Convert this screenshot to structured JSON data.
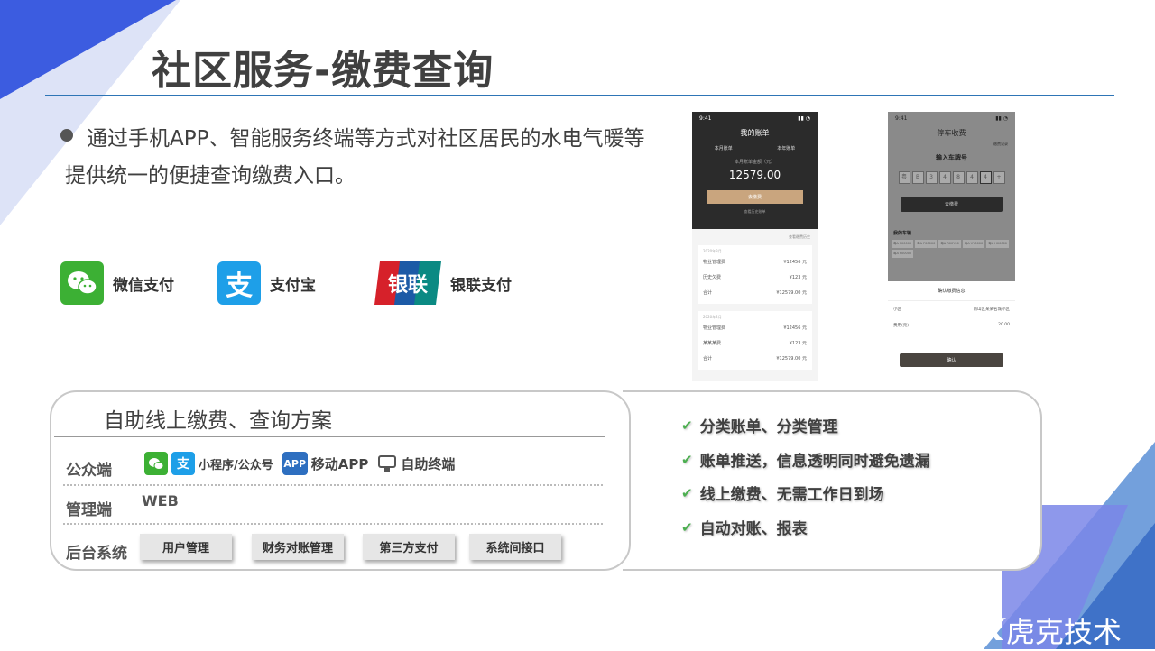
{
  "slide": {
    "title": "社区服务-缴费查询",
    "bullet": "通过手机APP、智能服务终端等方式对社区居民的水电气暖等提供统一的便捷查询缴费入口。"
  },
  "payments": [
    {
      "label": "微信支付",
      "icon": "wechat-icon",
      "color": "#3cb034"
    },
    {
      "label": "支付宝",
      "icon": "alipay-icon",
      "color": "#1e9fe8",
      "glyph": "支"
    },
    {
      "label": "银联支付",
      "icon": "unionpay-icon",
      "glyph": "银联"
    }
  ],
  "phone1": {
    "time": "9:41",
    "title": "我的账单",
    "tabs": [
      "本月账单",
      "本年账单"
    ],
    "amount_label": "本月账单金额（元）",
    "amount": "12579.00",
    "pay_button": "去缴费",
    "history_link": "查看历史账单",
    "history_right": "查看缴费历史",
    "cards": [
      {
        "month": "2020年3月",
        "rows": [
          [
            "物业管理费",
            "¥12456 元"
          ],
          [
            "历史欠费",
            "¥123 元"
          ],
          [
            "合计",
            "¥12579.00 元"
          ]
        ]
      },
      {
        "month": "2020年2月",
        "rows": [
          [
            "物业管理费",
            "¥12456 元"
          ],
          [
            "某某某费",
            "¥123 元"
          ],
          [
            "合计",
            "¥12579.00 元"
          ]
        ]
      }
    ]
  },
  "phone2": {
    "time": "9:41",
    "title": "停车收费",
    "record_link": "缴费记录",
    "plate_label": "输入车牌号",
    "plate_chars": [
      "粤",
      "B",
      "3",
      "4",
      "8",
      "4",
      "4",
      "+"
    ],
    "pay_button": "去缴费",
    "cars_label": "我的车辆",
    "cars": [
      "粤A F00000",
      "粤A F00000",
      "粤A R00Y00",
      "粤A VY0000",
      "粤A H00000",
      "粤A F00000"
    ],
    "confirm_title": "确认缴费信息",
    "confirm_rows": [
      [
        "小区",
        "南山区某某名城小区"
      ],
      [
        "费用(元)",
        "20.00"
      ]
    ],
    "confirm_button": "确认"
  },
  "scheme": {
    "title": "自助线上缴费、查询方案",
    "public_label": "公众端",
    "public_items": {
      "mini": "小程序/公众号",
      "app_badge": "APP",
      "app": "移动APP",
      "terminal": "自助终端"
    },
    "admin_label": "管理端",
    "admin_value": "WEB",
    "backend_label": "后台系统",
    "backend_chips": [
      "用户管理",
      "财务对账管理",
      "第三方支付",
      "系统间接口"
    ]
  },
  "features": [
    "分类账单、分类管理",
    "账单推送，信息透明同时避免遗漏",
    "线上缴费、无需工作日到场",
    "自动对账、报表"
  ],
  "brand": {
    "logo_text": "HK",
    "name": "虎克技术"
  },
  "colors": {
    "accent": "#2e75b6",
    "wechat": "#3cb034",
    "alipay": "#1e9fe8",
    "unionpay_red": "#d6212a",
    "unionpay_blue": "#1c5aa6",
    "unionpay_green": "#0b8a83"
  }
}
